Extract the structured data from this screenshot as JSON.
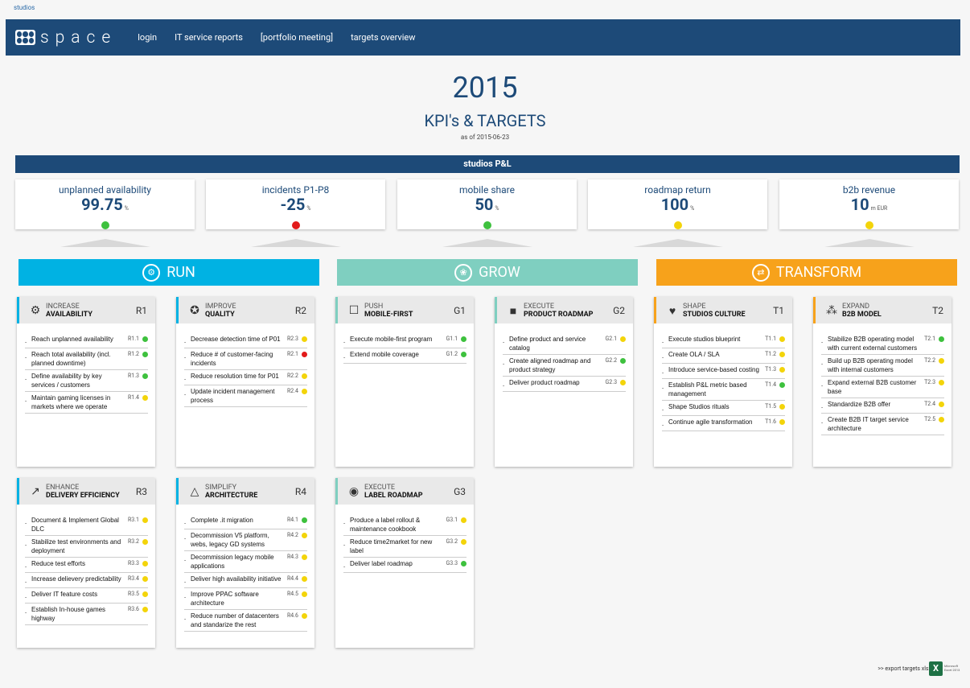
{
  "breadcrumb": "studios",
  "logo_text": "space",
  "nav": [
    "login",
    "IT service reports",
    "[portfolio meeting]",
    "targets overview"
  ],
  "year": "2015",
  "subtitle": "KPI's & TARGETS",
  "as_of": "as of 2015-06-23",
  "pl_title": "studios P&L",
  "colors": {
    "green": "#3ec13e",
    "red": "#e21b1b",
    "yellow": "#f3d40a",
    "run": "#00b2e3",
    "grow": "#7fcfc0",
    "transform": "#f7a21b",
    "navy": "#1d4a78"
  },
  "kpis": [
    {
      "label": "unplanned availability",
      "value": "99.75",
      "unit": "%",
      "status": "green"
    },
    {
      "label": "incidents P1-P8",
      "value": "-25",
      "unit": "%",
      "status": "red"
    },
    {
      "label": "mobile share",
      "value": "50",
      "unit": "%",
      "status": "green"
    },
    {
      "label": "roadmap return",
      "value": "100",
      "unit": "%",
      "status": "yellow"
    },
    {
      "label": "b2b revenue",
      "value": "10",
      "unit": "m EUR",
      "status": "yellow"
    }
  ],
  "categories": [
    {
      "label": "RUN",
      "icon": "gears-icon"
    },
    {
      "label": "GROW",
      "icon": "plant-icon"
    },
    {
      "label": "TRANSFORM",
      "icon": "transform-icon"
    }
  ],
  "cards": [
    {
      "small": "INCREASE",
      "big": "AVAILABILITY",
      "code": "R1",
      "icon": "gears-icon",
      "glyph": "⚙",
      "items": [
        {
          "text": "Reach unplanned availability",
          "code": "R1.1",
          "status": "green"
        },
        {
          "text": "Reach total availability (incl. planned downtime)",
          "code": "R1.2",
          "status": "green"
        },
        {
          "text": "Define availability by key services / customers",
          "code": "R1.3",
          "status": "green"
        },
        {
          "text": "Maintain gaming licenses in markets where we operate",
          "code": "R1.4",
          "status": "yellow"
        }
      ]
    },
    {
      "small": "IMPROVE",
      "big": "QUALITY",
      "code": "R2",
      "icon": "award-icon",
      "glyph": "✪",
      "items": [
        {
          "text": "Decrease detection time of P01",
          "code": "R2.3",
          "status": "yellow"
        },
        {
          "text": "Reduce # of customer-facing incidents",
          "code": "R2.1",
          "status": "red"
        },
        {
          "text": "Reduce resolution time for P01",
          "code": "R2.2",
          "status": "yellow"
        },
        {
          "text": "Update incident management process",
          "code": "R2.4",
          "status": "yellow"
        }
      ]
    },
    {
      "small": "PUSH",
      "big": "MOBILE-FIRST",
      "code": "G1",
      "icon": "mobile-icon",
      "glyph": "☐",
      "items": [
        {
          "text": "Execute mobile-first program",
          "code": "G1.1",
          "status": "green"
        },
        {
          "text": "Extend mobile coverage",
          "code": "G1.2",
          "status": "green"
        }
      ]
    },
    {
      "small": "EXECUTE",
      "big": "PRODUCT ROADMAP",
      "code": "G2",
      "icon": "shapes-icon",
      "glyph": "■",
      "items": [
        {
          "text": "Define product and service catalog",
          "code": "G2.1",
          "status": "yellow"
        },
        {
          "text": "Create aligned roadmap and product strategy",
          "code": "G2.2",
          "status": "green"
        },
        {
          "text": "Deliver product roadmap",
          "code": "G2.3",
          "status": "yellow"
        }
      ]
    },
    {
      "small": "SHAPE",
      "big": "STUDIOS CULTURE",
      "code": "T1",
      "icon": "heart-icon",
      "glyph": "♥",
      "items": [
        {
          "text": "Execute studios blueprint",
          "code": "T1.1",
          "status": "yellow"
        },
        {
          "text": "Create OLA / SLA",
          "code": "T1.2",
          "status": "yellow"
        },
        {
          "text": "Introduce service-based costing",
          "code": "T1.3",
          "status": "yellow"
        },
        {
          "text": "Establish P&L metric based management",
          "code": "T1.4",
          "status": "green"
        },
        {
          "text": "Shape Studios rituals",
          "code": "T1.5",
          "status": "yellow"
        },
        {
          "text": "Continue agile transformation",
          "code": "T1.6",
          "status": "yellow"
        }
      ]
    },
    {
      "small": "EXPAND",
      "big": "B2B MODEL",
      "code": "T2",
      "icon": "network-icon",
      "glyph": "⁂",
      "items": [
        {
          "text": "Stabilize B2B operating model with current external customers",
          "code": "T2.1",
          "status": "green"
        },
        {
          "text": "Build up B2B operating model with internal customers",
          "code": "T2.2",
          "status": "yellow"
        },
        {
          "text": "Expand external B2B customer base",
          "code": "T2.3",
          "status": "yellow"
        },
        {
          "text": "Standardize B2B offer",
          "code": "T2.4",
          "status": "yellow"
        },
        {
          "text": "Create B2B IT target service architecture",
          "code": "T2.5",
          "status": "yellow"
        }
      ]
    },
    {
      "small": "ENHANCE",
      "big": "DELIVERY EFFICIENCY",
      "code": "R3",
      "icon": "chart-icon",
      "glyph": "↗",
      "items": [
        {
          "text": "Document & Implement Global DLC",
          "code": "R3.1",
          "status": "yellow"
        },
        {
          "text": "Stabilize test environments and deployment",
          "code": "R3.2",
          "status": "yellow"
        },
        {
          "text": "Reduce test efforts",
          "code": "R3.3",
          "status": "yellow"
        },
        {
          "text": "Increase delievery predictability",
          "code": "R3.4",
          "status": "yellow"
        },
        {
          "text": "Deliver IT feature costs",
          "code": "R3.5",
          "status": "yellow"
        },
        {
          "text": "Establish In-house games highway",
          "code": "R3.6",
          "status": "yellow"
        }
      ]
    },
    {
      "small": "SIMPLIFY",
      "big": "ARCHITECTURE",
      "code": "R4",
      "icon": "shapes-outline-icon",
      "glyph": "△",
      "items": [
        {
          "text": "Complete .it migration",
          "code": "R4.1",
          "status": "green"
        },
        {
          "text": "Decommission V5 platform, webs, legacy GD systems",
          "code": "R4.2",
          "status": "yellow"
        },
        {
          "text": "Decommission legacy mobile applications",
          "code": "R4.3",
          "status": "yellow"
        },
        {
          "text": "Deliver high availability initiative",
          "code": "R4.4",
          "status": "yellow"
        },
        {
          "text": "Improve PPAC software architecture",
          "code": "R4.5",
          "status": "yellow"
        },
        {
          "text": "Reduce number of datacenters and standarize the rest",
          "code": "R4.6",
          "status": "yellow"
        }
      ]
    },
    {
      "small": "EXECUTE",
      "big": "LABEL ROADMAP",
      "code": "G3",
      "icon": "globe-icon",
      "glyph": "◉",
      "items": [
        {
          "text": "Produce a label rollout & maintenance cookbook",
          "code": "G3.1",
          "status": "yellow"
        },
        {
          "text": "Reduce time2market for new label",
          "code": "G3.2",
          "status": "yellow"
        },
        {
          "text": "Deliver label roadmap",
          "code": "G3.3",
          "status": "green"
        }
      ]
    }
  ],
  "export_text": ">> export targets xlsx",
  "excel_icon": "excel-icon"
}
